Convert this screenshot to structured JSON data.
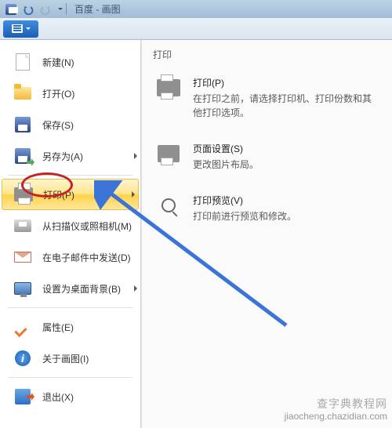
{
  "window": {
    "title": "百度 - 画图"
  },
  "menu": {
    "new_label": "新建(N)",
    "open_label": "打开(O)",
    "save_label": "保存(S)",
    "saveas_label": "另存为(A)",
    "print_label": "打印(P)",
    "scan_label": "从扫描仪或照相机(M)",
    "email_label": "在电子邮件中发送(D)",
    "wallpaper_label": "设置为桌面背景(B)",
    "properties_label": "属性(E)",
    "about_label": "关于画图(I)",
    "exit_label": "退出(X)"
  },
  "submenu": {
    "title": "打印",
    "print": {
      "title": "打印(P)",
      "desc": "在打印之前，请选择打印机、打印份数和其他打印选项。"
    },
    "page_setup": {
      "title": "页面设置(S)",
      "desc": "更改图片布局。"
    },
    "preview": {
      "title": "打印预览(V)",
      "desc": "打印前进行预览和修改。"
    }
  },
  "watermark": {
    "line1": "查字典教程网",
    "line2": "jiaocheng.chazidian.com"
  }
}
